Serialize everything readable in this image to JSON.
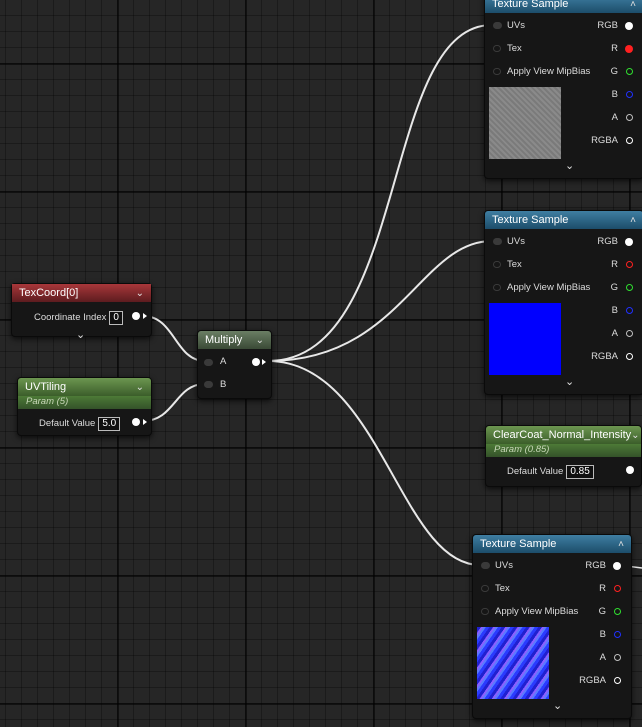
{
  "texcoord": {
    "title": "TexCoord[0]",
    "label": "Coordinate Index",
    "value": "0"
  },
  "uvtiling": {
    "title": "UVTiling",
    "subtitle": "Param (5)",
    "label": "Default Value",
    "value": "5.0"
  },
  "multiply": {
    "title": "Multiply",
    "a": "A",
    "b": "B"
  },
  "clearcoat": {
    "title": "ClearCoat_Normal_Intensity",
    "subtitle": "Param (0.85)",
    "label": "Default Value",
    "value": "0.85"
  },
  "texture_samples": [
    {
      "title": "Texture Sample",
      "inputs": [
        "UVs",
        "Tex",
        "Apply View MipBias"
      ],
      "outputs": [
        "RGB",
        "R",
        "G",
        "B",
        "A",
        "RGBA"
      ],
      "preview": "gray-noise-texture"
    },
    {
      "title": "Texture Sample",
      "inputs": [
        "UVs",
        "Tex",
        "Apply View MipBias"
      ],
      "outputs": [
        "RGB",
        "R",
        "G",
        "B",
        "A",
        "RGBA"
      ],
      "preview": "solid-blue-texture"
    },
    {
      "title": "Texture Sample",
      "inputs": [
        "UVs",
        "Tex",
        "Apply View MipBias"
      ],
      "outputs": [
        "RGB",
        "R",
        "G",
        "B",
        "A",
        "RGBA"
      ],
      "preview": "diagonal-normal-map-texture"
    }
  ],
  "colors": {
    "r": "#ff2020",
    "g": "#30e030",
    "b": "#2030ff",
    "a": "#c0c0c0",
    "rgba": "#ffffff",
    "blue_swatch": "#0000ff"
  },
  "icons": {
    "collapse": "chevron-up-icon",
    "expand": "chevron-down-icon"
  }
}
